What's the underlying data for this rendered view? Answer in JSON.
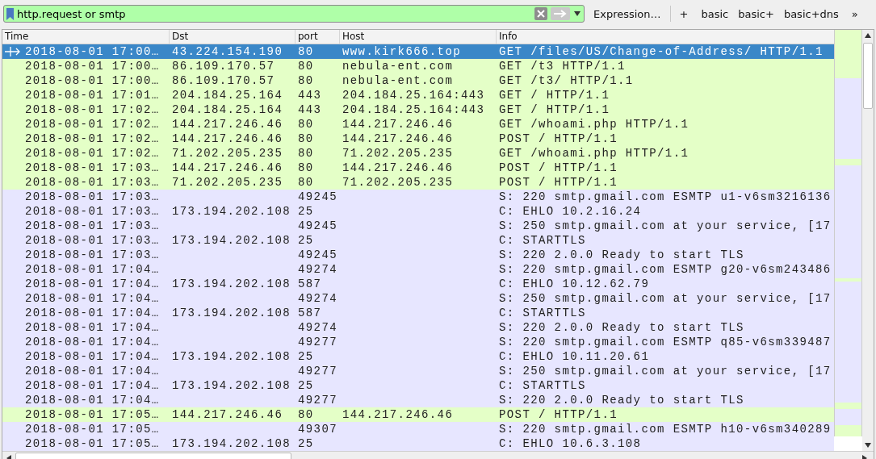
{
  "filter": {
    "value": "http.request or smtp"
  },
  "toolbar": {
    "expression": "Expression…",
    "add": "+",
    "buttons": [
      "basic",
      "basic+",
      "basic+dns"
    ],
    "more": "»"
  },
  "table": {
    "columns": [
      "Time",
      "Dst",
      "port",
      "Host",
      "Info"
    ],
    "rows": [
      {
        "kind": "http",
        "selected": true,
        "time": "2018-08-01 17:00…",
        "dst": "43.224.154.190",
        "port": "80",
        "host": "www.kirk666.top",
        "info": "GET /files/US/Change-of-Address/ HTTP/1.1"
      },
      {
        "kind": "http",
        "selected": false,
        "time": "2018-08-01 17:00…",
        "dst": "86.109.170.57",
        "port": "80",
        "host": "nebula-ent.com",
        "info": "GET /t3 HTTP/1.1"
      },
      {
        "kind": "http",
        "selected": false,
        "time": "2018-08-01 17:00…",
        "dst": "86.109.170.57",
        "port": "80",
        "host": "nebula-ent.com",
        "info": "GET /t3/ HTTP/1.1"
      },
      {
        "kind": "http",
        "selected": false,
        "time": "2018-08-01 17:01…",
        "dst": "204.184.25.164",
        "port": "443",
        "host": "204.184.25.164:443",
        "info": "GET / HTTP/1.1"
      },
      {
        "kind": "http",
        "selected": false,
        "time": "2018-08-01 17:02…",
        "dst": "204.184.25.164",
        "port": "443",
        "host": "204.184.25.164:443",
        "info": "GET / HTTP/1.1"
      },
      {
        "kind": "http",
        "selected": false,
        "time": "2018-08-01 17:02…",
        "dst": "144.217.246.46",
        "port": "80",
        "host": "144.217.246.46",
        "info": "GET /whoami.php HTTP/1.1"
      },
      {
        "kind": "http",
        "selected": false,
        "time": "2018-08-01 17:02…",
        "dst": "144.217.246.46",
        "port": "80",
        "host": "144.217.246.46",
        "info": "POST / HTTP/1.1"
      },
      {
        "kind": "http",
        "selected": false,
        "time": "2018-08-01 17:02…",
        "dst": "71.202.205.235",
        "port": "80",
        "host": "71.202.205.235",
        "info": "GET /whoami.php HTTP/1.1"
      },
      {
        "kind": "http",
        "selected": false,
        "time": "2018-08-01 17:03…",
        "dst": "144.217.246.46",
        "port": "80",
        "host": "144.217.246.46",
        "info": "POST / HTTP/1.1"
      },
      {
        "kind": "http",
        "selected": false,
        "time": "2018-08-01 17:03…",
        "dst": "71.202.205.235",
        "port": "80",
        "host": "71.202.205.235",
        "info": "POST / HTTP/1.1"
      },
      {
        "kind": "smtp",
        "selected": false,
        "time": "2018-08-01 17:03…",
        "port": "49245",
        "info": "S: 220 smtp.gmail.com ESMTP u1-v6sm3216136"
      },
      {
        "kind": "smtp",
        "selected": false,
        "time": "2018-08-01 17:03…",
        "dst": "173.194.202.108",
        "port": "25",
        "info": "C: EHLO 10.2.16.24"
      },
      {
        "kind": "smtp",
        "selected": false,
        "time": "2018-08-01 17:03…",
        "port": "49245",
        "info": "S: 250 smtp.gmail.com at your service, [17"
      },
      {
        "kind": "smtp",
        "selected": false,
        "time": "2018-08-01 17:03…",
        "dst": "173.194.202.108",
        "port": "25",
        "info": "C: STARTTLS"
      },
      {
        "kind": "smtp",
        "selected": false,
        "time": "2018-08-01 17:03…",
        "port": "49245",
        "info": "S: 220 2.0.0 Ready to start TLS"
      },
      {
        "kind": "smtp",
        "selected": false,
        "time": "2018-08-01 17:04…",
        "port": "49274",
        "info": "S: 220 smtp.gmail.com ESMTP g20-v6sm243486"
      },
      {
        "kind": "smtp",
        "selected": false,
        "time": "2018-08-01 17:04…",
        "dst": "173.194.202.108",
        "port": "587",
        "info": "C: EHLO 10.12.62.79"
      },
      {
        "kind": "smtp",
        "selected": false,
        "time": "2018-08-01 17:04…",
        "port": "49274",
        "info": "S: 250 smtp.gmail.com at your service, [17"
      },
      {
        "kind": "smtp",
        "selected": false,
        "time": "2018-08-01 17:04…",
        "dst": "173.194.202.108",
        "port": "587",
        "info": "C: STARTTLS"
      },
      {
        "kind": "smtp",
        "selected": false,
        "time": "2018-08-01 17:04…",
        "port": "49274",
        "info": "S: 220 2.0.0 Ready to start TLS"
      },
      {
        "kind": "smtp",
        "selected": false,
        "time": "2018-08-01 17:04…",
        "port": "49277",
        "info": "S: 220 smtp.gmail.com ESMTP q85-v6sm339487"
      },
      {
        "kind": "smtp",
        "selected": false,
        "time": "2018-08-01 17:04…",
        "dst": "173.194.202.108",
        "port": "25",
        "info": "C: EHLO 10.11.20.61"
      },
      {
        "kind": "smtp",
        "selected": false,
        "time": "2018-08-01 17:04…",
        "port": "49277",
        "info": "S: 250 smtp.gmail.com at your service, [17"
      },
      {
        "kind": "smtp",
        "selected": false,
        "time": "2018-08-01 17:04…",
        "dst": "173.194.202.108",
        "port": "25",
        "info": "C: STARTTLS"
      },
      {
        "kind": "smtp",
        "selected": false,
        "time": "2018-08-01 17:04…",
        "port": "49277",
        "info": "S: 220 2.0.0 Ready to start TLS"
      },
      {
        "kind": "http",
        "selected": false,
        "time": "2018-08-01 17:05…",
        "dst": "144.217.246.46",
        "port": "80",
        "host": "144.217.246.46",
        "info": "POST / HTTP/1.1"
      },
      {
        "kind": "smtp",
        "selected": false,
        "time": "2018-08-01 17:05…",
        "port": "49307",
        "info": "S: 220 smtp.gmail.com ESMTP h10-v6sm340289"
      },
      {
        "kind": "smtp",
        "selected": false,
        "time": "2018-08-01 17:05…",
        "dst": "173.194.202.108",
        "port": "25",
        "info": "C: EHLO 10.6.3.108"
      }
    ]
  }
}
